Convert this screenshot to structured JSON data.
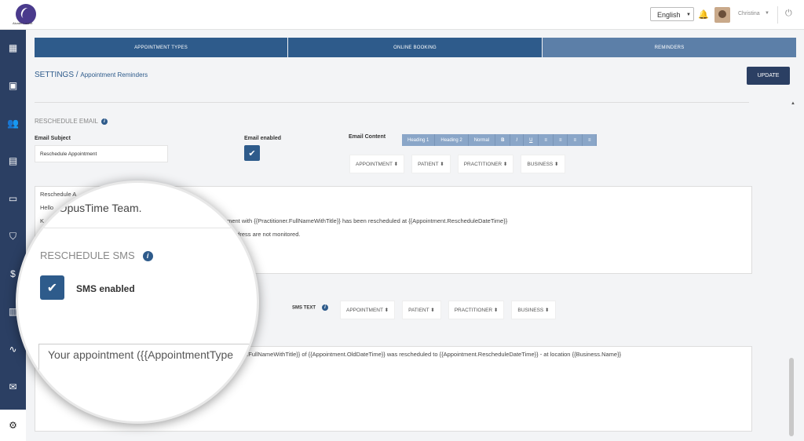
{
  "header": {
    "logo_text": "Alcatel-Lucent",
    "language": "English",
    "user_name": "Christina"
  },
  "tabs": [
    {
      "label": "APPOINTMENT TYPES"
    },
    {
      "label": "ONLINE BOOKING"
    },
    {
      "label": "REMINDERS"
    }
  ],
  "breadcrumb": {
    "root": "SETTINGS",
    "separator": " / ",
    "current": "Appointment Reminders"
  },
  "update_label": "UPDATE",
  "email": {
    "section_title": "RESCHEDULE EMAIL",
    "subject_label": "Email Subject",
    "subject_value": "Reschedule Appointment",
    "enabled_label": "Email enabled",
    "content_label": "Email Content",
    "toolbar": [
      "Heading 1",
      "Heading 2",
      "Normal",
      "B",
      "I",
      "U",
      "≡",
      "≡",
      "≡",
      "≡"
    ],
    "fields": [
      "APPOINTMENT ⬍",
      "PATIENT ⬍",
      "PRACTITIONER ⬍",
      "BUSINESS ⬍"
    ],
    "body_lines": [
      "Reschedule A",
      "Hello",
      "K",
      "tment with {{Practitioner.FullNameWithTitle}} has been rescheduled at {{Appointment.RescheduleDateTime}}",
      "s address are not monitored."
    ]
  },
  "sms": {
    "text_label": "SMS TEXT",
    "fields": [
      "APPOINTMENT ⬍",
      "PATIENT ⬍",
      "PRACTITIONER ⬍",
      "BUSINESS ⬍"
    ],
    "body_rest": "e.FullNameWithTitle}} of {{Appointment.OldDateTime}} was rescheduled to {{Appointment.RescheduleDateTime}} - at location {{Business.Name}}"
  },
  "magnifier": {
    "team": "e OpusTime Team.",
    "section_title": "RESCHEDULE SMS",
    "sms_enabled_label": "SMS enabled",
    "sms_text": "Your appointment ({{AppointmentType"
  },
  "colors": {
    "navy": "#2b3f63",
    "tab_active": "#5c7fa8",
    "accent": "#2e5b8b"
  }
}
